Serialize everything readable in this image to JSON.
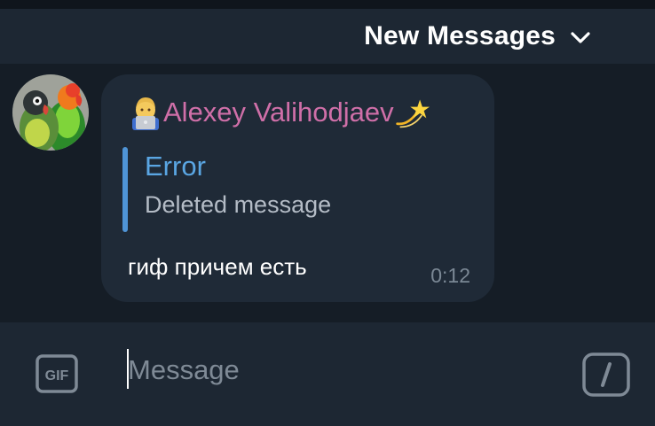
{
  "banner": {
    "label": "New Messages"
  },
  "message": {
    "sender": "Alexey Valihodjaev",
    "reply": {
      "title": "Error",
      "text": "Deleted message"
    },
    "text": "гиф причем есть",
    "time": "0:12"
  },
  "composer": {
    "placeholder": "Message",
    "gif_icon": "gif-icon",
    "commands_icon": "slash-commands-icon"
  },
  "colors": {
    "background": "#151d26",
    "panel": "#1d2733",
    "bubble": "#1f2a37",
    "sender": "#cf6fa8",
    "reply_accent": "#4f94d6"
  }
}
